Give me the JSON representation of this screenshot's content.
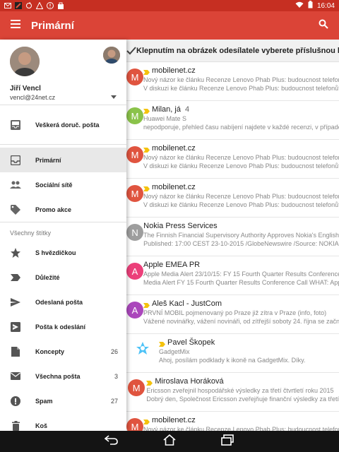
{
  "status_bar": {
    "time": "16:04"
  },
  "app_bar": {
    "title": "Primární"
  },
  "tip": {
    "text": "Klepnutím na obrázek odesílatele vyberete příslušnou konverzaci"
  },
  "account": {
    "name": "Jiří Vencl",
    "email": "vencl@24net.cz"
  },
  "drawer": {
    "top_item": {
      "label": "Veškerá doruč. pošta"
    },
    "categories": [
      {
        "label": "Primární"
      },
      {
        "label": "Sociální sítě"
      },
      {
        "label": "Promo akce"
      }
    ],
    "section_title": "Všechny štítky",
    "labels": [
      {
        "label": "S hvězdičkou",
        "count": ""
      },
      {
        "label": "Důležité",
        "count": ""
      },
      {
        "label": "Odeslaná pošta",
        "count": ""
      },
      {
        "label": "Pošta k odeslání",
        "count": ""
      },
      {
        "label": "Koncepty",
        "count": "26"
      },
      {
        "label": "Všechna pošta",
        "count": "3"
      },
      {
        "label": "Spam",
        "count": "27"
      },
      {
        "label": "Koš",
        "count": ""
      }
    ]
  },
  "messages": [
    {
      "letter": "M",
      "color": "#e0543f",
      "from": "mobilenet.cz",
      "count": "",
      "important": true,
      "line2": "Nový názor ke článku Recenze Lenovo Phab Plus: budoucnost telefonů?",
      "line3": "V diskuzi ke článku Recenze Lenovo Phab Plus: budoucnost telefonů?"
    },
    {
      "letter": "M",
      "color": "#8bc34a",
      "from": "Milan, já",
      "count": "4",
      "important": true,
      "line2": "Huawei Mate S",
      "line3": "nepodporuje, přehled času nabíjení najdete v každé recenzi, v případě"
    },
    {
      "letter": "M",
      "color": "#e0543f",
      "from": "mobilenet.cz",
      "count": "",
      "important": true,
      "line2": "Nový názor ke článku Recenze Lenovo Phab Plus: budoucnost telefonů?",
      "line3": "V diskuzi ke článku Recenze Lenovo Phab Plus: budoucnost telefonů?"
    },
    {
      "letter": "M",
      "color": "#e0543f",
      "from": "mobilenet.cz",
      "count": "",
      "important": true,
      "line2": "Nový názor ke článku Recenze Lenovo Phab Plus: budoucnost telefonů?",
      "line3": "V diskuzi ke článku Recenze Lenovo Phab Plus: budoucnost telefonů?"
    },
    {
      "letter": "N",
      "color": "#9e9e9e",
      "from": "Nokia Press Services",
      "count": "",
      "important": false,
      "line2": "The Finnish Financial Supervisory Authority Approves Nokia's English",
      "line3": "Published: 17:00 CEST 23-10-2015 /GlobeNewswire /Source: NOKIA"
    },
    {
      "letter": "A",
      "color": "#ec407a",
      "from": "Apple EMEA PR",
      "count": "",
      "important": false,
      "line2": "Apple Media Alert 23/10/15: FY 15 Fourth Quarter Results Conference",
      "line3": "Media Alert FY 15 Fourth Quarter Results Conference Call WHAT: Apple"
    },
    {
      "letter": "A",
      "color": "#ab47bc",
      "from": "Aleš Kacl - JustCom",
      "count": "",
      "important": true,
      "line2": "PRVNÍ MOBIL pojmenovaný po Praze již zítra v Praze (info, foto)",
      "line3": "Vážené novinářky, vážení novináři, od zítřejší soboty 24. října se začne"
    },
    {
      "letter": "",
      "color": "#ffffff",
      "from": "Pavel Škopek",
      "count": "",
      "important": true,
      "line2": "GadgetMix",
      "line3": "Ahoj, posílám podklady k ikoně na GadgetMix. Díky."
    },
    {
      "letter": "M",
      "color": "#e0543f",
      "from": "Miroslava Horáková",
      "count": "",
      "important": true,
      "line2": "Ericsson zveřejnil hospodářské výsledky za třetí čtvrtletí roku 2015",
      "line3": "Dobrý den, Společnost Ericsson zveřejňuje finanční výsledky za třetí"
    },
    {
      "letter": "M",
      "color": "#e0543f",
      "from": "mobilenet.cz",
      "count": "",
      "important": true,
      "line2": "Nový názor ke článku Recenze Lenovo Phab Plus: budoucnost telefonů?",
      "line3": "V diskuzi ke článku Recenze Lenovo Phab Plus: budoucnost telefonů?"
    }
  ]
}
